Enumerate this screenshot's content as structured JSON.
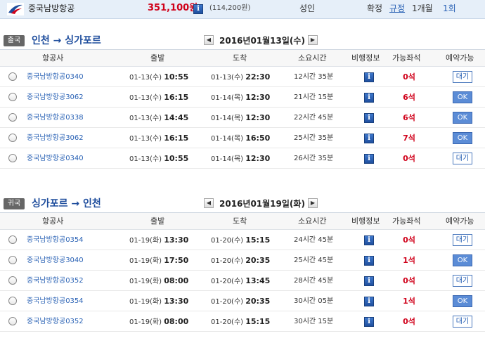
{
  "topbar": {
    "airline": "중국남방항공",
    "price": "351,100원",
    "tax": "(114,200원)",
    "pax": "성인",
    "confirm": "확정",
    "rule": "규정",
    "stay": "1개월",
    "count": "1회"
  },
  "headers": [
    "항공사",
    "출발",
    "도착",
    "소요시간",
    "비행정보",
    "가능좌석",
    "예약가능"
  ],
  "outbound": {
    "badge": "출국",
    "route": "인천 → 싱가포르",
    "date": "2016년01월13일(수)",
    "rows": [
      {
        "airline": "중국남방항공0340",
        "dep_date": "01-13(수)",
        "dep_time": "10:55",
        "arr_date": "01-13(수)",
        "arr_time": "22:30",
        "duration": "12시간 35분",
        "seats": "0석",
        "action": "대기",
        "ok": false
      },
      {
        "airline": "중국남방항공3062",
        "dep_date": "01-13(수)",
        "dep_time": "16:15",
        "arr_date": "01-14(목)",
        "arr_time": "12:30",
        "duration": "21시간 15분",
        "seats": "6석",
        "action": "OK",
        "ok": true
      },
      {
        "airline": "중국남방항공0338",
        "dep_date": "01-13(수)",
        "dep_time": "14:45",
        "arr_date": "01-14(목)",
        "arr_time": "12:30",
        "duration": "22시간 45분",
        "seats": "6석",
        "action": "OK",
        "ok": true
      },
      {
        "airline": "중국남방항공3062",
        "dep_date": "01-13(수)",
        "dep_time": "16:15",
        "arr_date": "01-14(목)",
        "arr_time": "16:50",
        "duration": "25시간 35분",
        "seats": "7석",
        "action": "OK",
        "ok": true
      },
      {
        "airline": "중국남방항공0340",
        "dep_date": "01-13(수)",
        "dep_time": "10:55",
        "arr_date": "01-14(목)",
        "arr_time": "12:30",
        "duration": "26시간 35분",
        "seats": "0석",
        "action": "대기",
        "ok": false
      }
    ]
  },
  "inbound": {
    "badge": "귀국",
    "route": "싱가포르 → 인천",
    "date": "2016년01월19일(화)",
    "rows": [
      {
        "airline": "중국남방항공0354",
        "dep_date": "01-19(화)",
        "dep_time": "13:30",
        "arr_date": "01-20(수)",
        "arr_time": "15:15",
        "duration": "24시간 45분",
        "seats": "0석",
        "action": "대기",
        "ok": false
      },
      {
        "airline": "중국남방항공3040",
        "dep_date": "01-19(화)",
        "dep_time": "17:50",
        "arr_date": "01-20(수)",
        "arr_time": "20:35",
        "duration": "25시간 45분",
        "seats": "1석",
        "action": "OK",
        "ok": true
      },
      {
        "airline": "중국남방항공0352",
        "dep_date": "01-19(화)",
        "dep_time": "08:00",
        "arr_date": "01-20(수)",
        "arr_time": "13:45",
        "duration": "28시간 45분",
        "seats": "0석",
        "action": "대기",
        "ok": false
      },
      {
        "airline": "중국남방항공0354",
        "dep_date": "01-19(화)",
        "dep_time": "13:30",
        "arr_date": "01-20(수)",
        "arr_time": "20:35",
        "duration": "30시간 05분",
        "seats": "1석",
        "action": "OK",
        "ok": true
      },
      {
        "airline": "중국남방항공0352",
        "dep_date": "01-19(화)",
        "dep_time": "08:00",
        "arr_date": "01-20(수)",
        "arr_time": "15:15",
        "duration": "30시간 15분",
        "seats": "0석",
        "action": "대기",
        "ok": false
      }
    ]
  },
  "icons": {
    "logo": "airline-logo-icon",
    "info": "info-icon",
    "prev": "prev-date-arrow-icon",
    "next": "next-date-arrow-icon"
  }
}
